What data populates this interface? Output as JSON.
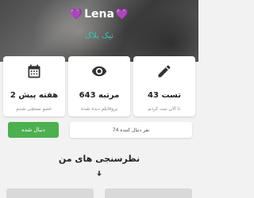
{
  "profile": {
    "name": "Lena",
    "heart_icon": "purple-heart-icon",
    "subtitle": "تیک بلاگ"
  },
  "stats": [
    {
      "icon": "pencil-icon",
      "value": "43 تست",
      "label": "تا الان ثبت کردم"
    },
    {
      "icon": "eye-icon",
      "value": "643 مرتبه",
      "label": "پروفایلم دیده شده"
    },
    {
      "icon": "calendar-icon",
      "value": "2 هفته پیش",
      "label": "عضو تستچی شدم"
    }
  ],
  "follow": {
    "button_label": "دنبال شده",
    "count_text": "74 نفر دنبال کننده"
  },
  "section": {
    "title": "نظرسنجی های من"
  },
  "colors": {
    "accent_green": "#4caf50",
    "subtitle_teal": "#37c6b6",
    "heart_purple": "#a24de6"
  }
}
